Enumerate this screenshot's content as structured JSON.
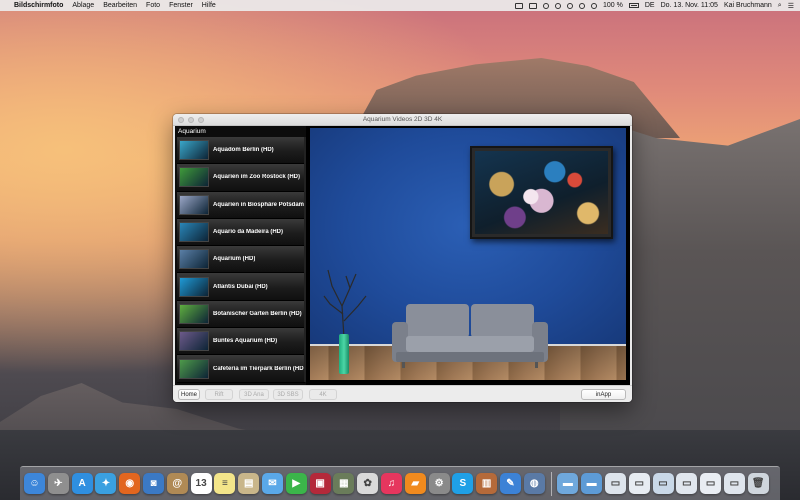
{
  "menubar": {
    "app_name": "Bildschirmfoto",
    "items": [
      "Ablage",
      "Bearbeiten",
      "Foto",
      "Fenster",
      "Hilfe"
    ],
    "battery": "100 %",
    "input_source": "DE",
    "datetime": "Do. 13. Nov.  11:05",
    "user": "Kai Bruchmann"
  },
  "window": {
    "title": "Aquarium Videos 2D 3D 4K",
    "sidebar_title": "Aquarium",
    "items": [
      {
        "label": "Aquadom Berlin (HD)",
        "thumb_color": "#3aa6c9"
      },
      {
        "label": "Aquarien im Zoo Rostock (HD)",
        "thumb_color": "#3f9a3a"
      },
      {
        "label": "Aquarien in Biosphäre Potsdam (",
        "thumb_color": "#9aa6c6"
      },
      {
        "label": "Aquario da Madeira (HD)",
        "thumb_color": "#2a86b8"
      },
      {
        "label": "Aquarium (HD)",
        "thumb_color": "#5a7fa6"
      },
      {
        "label": "Atlantis Dubai (HD)",
        "thumb_color": "#1f9ad6"
      },
      {
        "label": "Botanischer Garten Berlin (HD)",
        "thumb_color": "#5fae3f"
      },
      {
        "label": "Buntes Aquarium (HD)",
        "thumb_color": "#6d5a8a"
      },
      {
        "label": "Cafeteria im Tierpark Berlin (HD",
        "thumb_color": "#4e9a4a"
      }
    ],
    "toolbar": {
      "home": "Home",
      "rift": "Rift",
      "ana3d": "3D Ana",
      "sbs3d": "3D SBS",
      "k4": "4K",
      "inapp": "inApp"
    }
  },
  "colors": {
    "wall": "#1f4b9a",
    "menubar": "#ececec"
  },
  "dock": {
    "apps": [
      {
        "name": "finder-icon",
        "color": "#3d86d9",
        "glyph": "☺"
      },
      {
        "name": "launchpad-icon",
        "color": "#8f8f8f",
        "glyph": "✈"
      },
      {
        "name": "app-store-icon",
        "color": "#2f8fe0",
        "glyph": "A"
      },
      {
        "name": "safari-icon",
        "color": "#3aa0e0",
        "glyph": "✦"
      },
      {
        "name": "firefox-icon",
        "color": "#e2661f",
        "glyph": "◉"
      },
      {
        "name": "iphoto-icon",
        "color": "#3b79c4",
        "glyph": "◙"
      },
      {
        "name": "contacts-icon",
        "color": "#b08a55",
        "glyph": "@"
      },
      {
        "name": "calendar-icon",
        "color": "#ffffff",
        "glyph": "13"
      },
      {
        "name": "notes-icon",
        "color": "#f3e58a",
        "glyph": "≡"
      },
      {
        "name": "preview-icon",
        "color": "#c9b68a",
        "glyph": "▤"
      },
      {
        "name": "messages-icon",
        "color": "#5aa8e8",
        "glyph": "✉"
      },
      {
        "name": "facetime-icon",
        "color": "#3bb54a",
        "glyph": "▶"
      },
      {
        "name": "photo-booth-icon",
        "color": "#b4293a",
        "glyph": "▣"
      },
      {
        "name": "image-capture-icon",
        "color": "#6a7c5a",
        "glyph": "▦"
      },
      {
        "name": "photos-icon",
        "color": "#d9d9d9",
        "glyph": "✿"
      },
      {
        "name": "itunes-icon",
        "color": "#e6365e",
        "glyph": "♫"
      },
      {
        "name": "ibooks-icon",
        "color": "#f08a1e",
        "glyph": "▰"
      },
      {
        "name": "system-preferences-icon",
        "color": "#8a8a8a",
        "glyph": "⚙"
      },
      {
        "name": "skype-icon",
        "color": "#1fa0e6",
        "glyph": "S"
      },
      {
        "name": "app-folder-icon",
        "color": "#b56a3a",
        "glyph": "▥"
      },
      {
        "name": "xcode-icon",
        "color": "#3c82d6",
        "glyph": "✎"
      },
      {
        "name": "network-icon",
        "color": "#5a7aa6",
        "glyph": "◍"
      }
    ],
    "folders": [
      {
        "name": "folder-icon",
        "color": "#6fa8dc",
        "glyph": "▬"
      },
      {
        "name": "downloads-folder-icon",
        "color": "#5d9bd6",
        "glyph": "▬"
      },
      {
        "name": "window-thumbnail-1-icon",
        "color": "#dde4ec",
        "glyph": "▭"
      },
      {
        "name": "window-thumbnail-2-icon",
        "color": "#e7ecf2",
        "glyph": "▭"
      },
      {
        "name": "window-thumbnail-3-icon",
        "color": "#c9d8e8",
        "glyph": "▭"
      },
      {
        "name": "window-thumbnail-4-icon",
        "color": "#e0e6ee",
        "glyph": "▭"
      },
      {
        "name": "window-thumbnail-5-icon",
        "color": "#e9edf3",
        "glyph": "▭"
      },
      {
        "name": "window-thumbnail-6-icon",
        "color": "#dfe5ed",
        "glyph": "▭"
      },
      {
        "name": "trash-icon",
        "color": "#cfd6dd",
        "glyph": "🗑"
      }
    ]
  }
}
